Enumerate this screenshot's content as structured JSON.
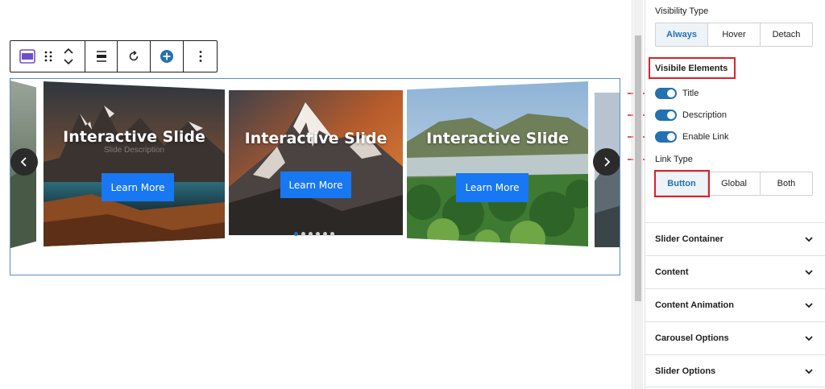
{
  "toolbar": {
    "block_icon": "slider-block-icon",
    "drag_icon": "drag-handle-icon",
    "move_icon": "move-up-down-icon",
    "align_icon": "align-icon",
    "rotate_icon": "rotate-icon",
    "add_icon": "plus-circle-icon",
    "more_icon": "more-options-icon"
  },
  "slides": [
    {
      "title": "",
      "button": ""
    },
    {
      "title": "Interactive Slide",
      "description": "Slide Description",
      "button": "Learn More"
    },
    {
      "title": "Interactive Slide",
      "description": "",
      "button": "Learn More"
    },
    {
      "title": "Interactive Slide",
      "description": "",
      "button": "Learn More"
    },
    {
      "title": "",
      "button": ""
    }
  ],
  "slider_nav": {
    "prev_icon": "chevron-left-icon",
    "next_icon": "chevron-right-icon"
  },
  "sidebar": {
    "visibility_type": {
      "label": "Visibility Type",
      "options": [
        "Always",
        "Hover",
        "Detach"
      ],
      "selected": "Always"
    },
    "visible_elements": {
      "heading": "Visibile Elements",
      "toggles": [
        {
          "label": "Title",
          "on": true
        },
        {
          "label": "Description",
          "on": true
        },
        {
          "label": "Enable Link",
          "on": true
        }
      ]
    },
    "link_type": {
      "label": "Link Type",
      "options": [
        "Button",
        "Global",
        "Both"
      ],
      "selected": "Button"
    },
    "panels": [
      {
        "title": "Slider Container"
      },
      {
        "title": "Content"
      },
      {
        "title": "Content Animation"
      },
      {
        "title": "Carousel Options"
      },
      {
        "title": "Slider Options"
      }
    ]
  },
  "colors": {
    "accent": "#2271b1",
    "callout": "#d9222a",
    "button": "#1877f2",
    "border": "#d0d0d0"
  }
}
